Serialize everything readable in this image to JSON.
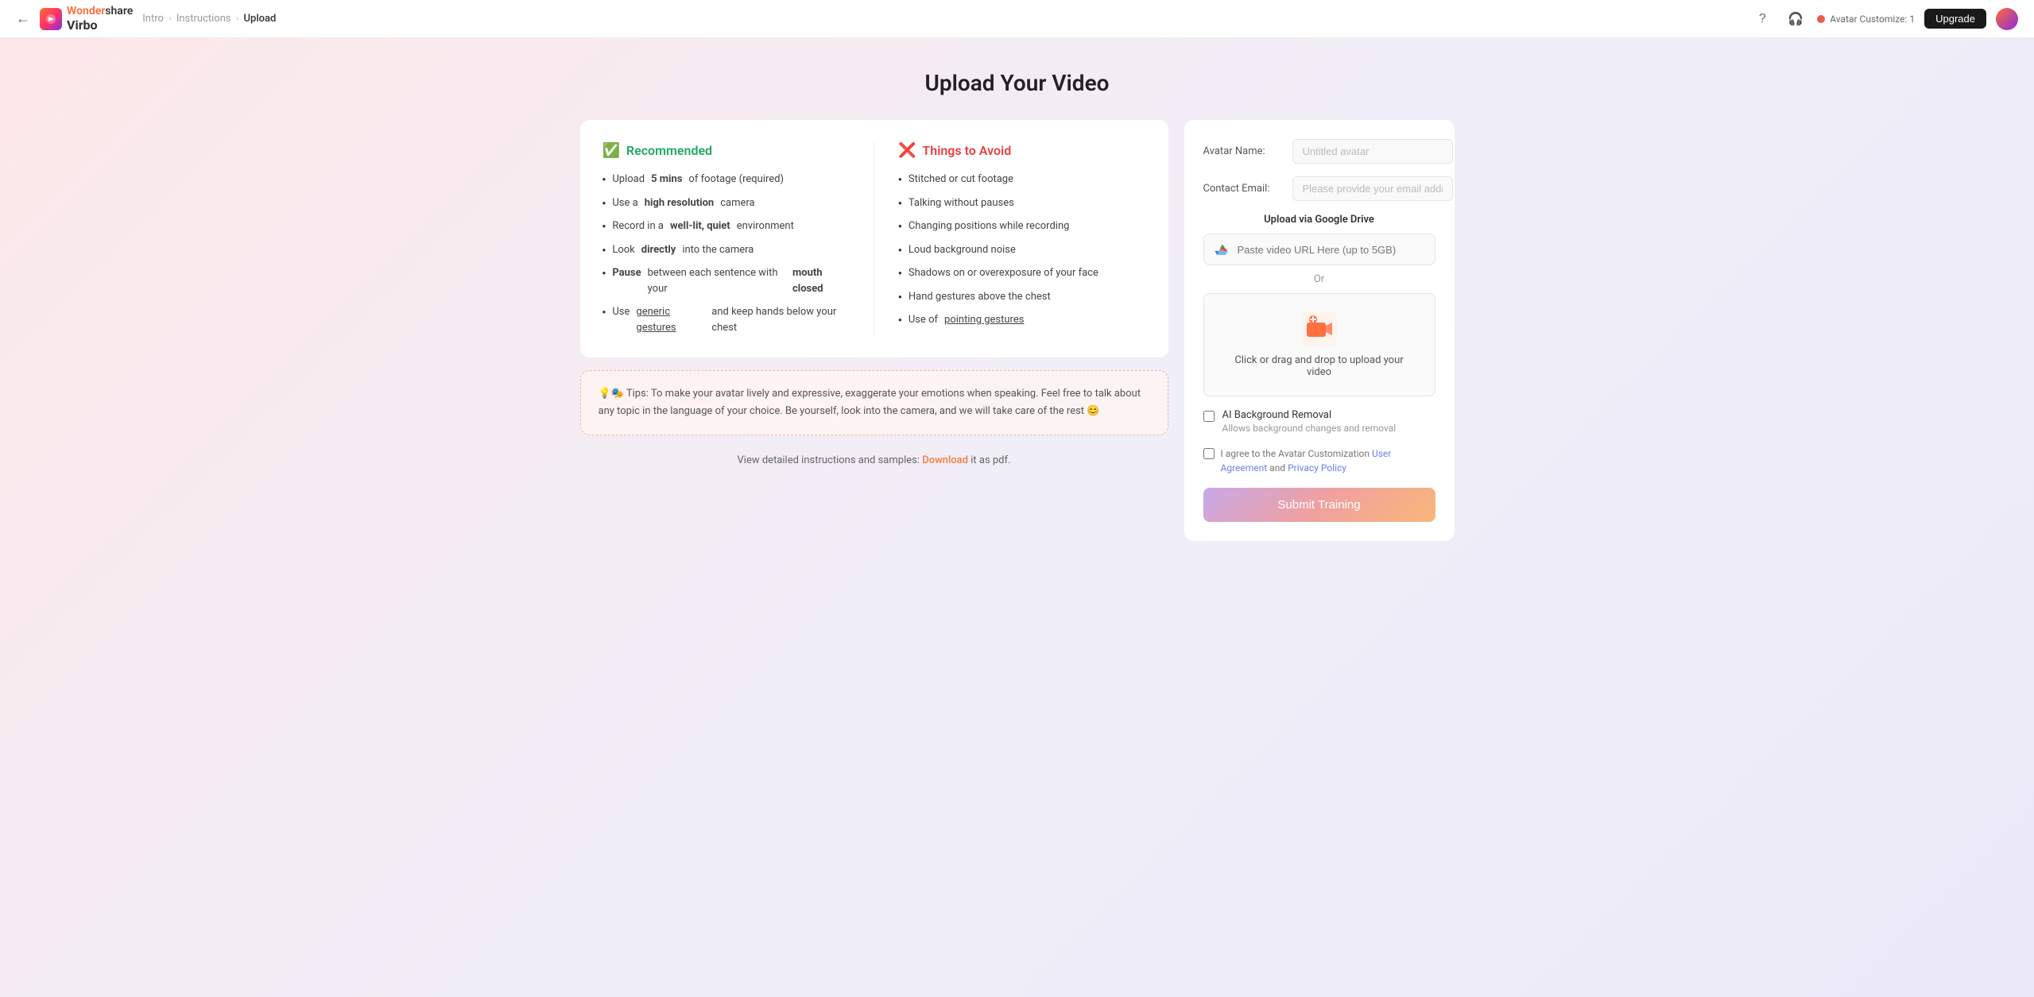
{
  "header": {
    "back_icon": "←",
    "logo_text": "Virbo",
    "breadcrumb": {
      "intro": "Intro",
      "instructions": "Instructions",
      "upload": "Upload"
    },
    "help_icon": "?",
    "headphones_icon": "🎧",
    "avatar_customize_label": "Avatar Customize: 1",
    "upgrade_label": "Upgrade"
  },
  "page": {
    "title": "Upload Your Video"
  },
  "left_panel": {
    "recommended": {
      "header_icon": "✅",
      "title": "Recommended",
      "items": [
        {
          "text_html": "Upload <strong>5 mins</strong> of footage (required)"
        },
        {
          "text_html": "Use a <strong>high resolution</strong> camera"
        },
        {
          "text_html": "Record in a <strong>well-lit, quiet</strong> environment"
        },
        {
          "text_html": "Look <strong>directly</strong> into the camera"
        },
        {
          "text_html": "<strong>Pause</strong> between each sentence with your <strong>mouth closed</strong>"
        },
        {
          "text_html": "Use <u>generic gestures</u> and keep hands below your chest"
        }
      ]
    },
    "avoid": {
      "header_icon": "❌",
      "title": "Things to Avoid",
      "items": [
        "Stitched or cut footage",
        "Talking without pauses",
        "Changing positions while recording",
        "Loud background noise",
        "Shadows on or overexposure of your face",
        "Hand gestures above the chest",
        "Use of pointing gestures"
      ]
    },
    "tips": {
      "emoji1": "💡",
      "emoji2": "🎭",
      "text": "Tips: To make your avatar lively and expressive, exaggerate your emotions when speaking. Feel free to talk about any topic in the language of your choice. Be yourself, look into the camera, and we will take care of the rest",
      "emoji3": "😊"
    },
    "download_line": {
      "prefix": "View detailed instructions and samples:",
      "link_text": "Download",
      "suffix": "it as pdf."
    }
  },
  "right_panel": {
    "avatar_name_label": "Avatar Name:",
    "avatar_name_placeholder": "Untitled avatar",
    "contact_email_label": "Contact Email:",
    "contact_email_placeholder": "Please provide your email address",
    "upload_gdrive_label": "Upload via Google Drive",
    "gdrive_placeholder": "Paste video URL Here (up to 5GB)",
    "or_label": "Or",
    "upload_drop_text": "Click or drag and drop to upload your video",
    "ai_removal_title": "AI Background Removal",
    "ai_removal_desc": "Allows background changes and removal",
    "agree_text_prefix": "I agree to the Avatar Customization",
    "agree_link1": "User Agreement",
    "agree_and": "and",
    "agree_link2": "Privacy Policy",
    "submit_label": "Submit Training"
  }
}
